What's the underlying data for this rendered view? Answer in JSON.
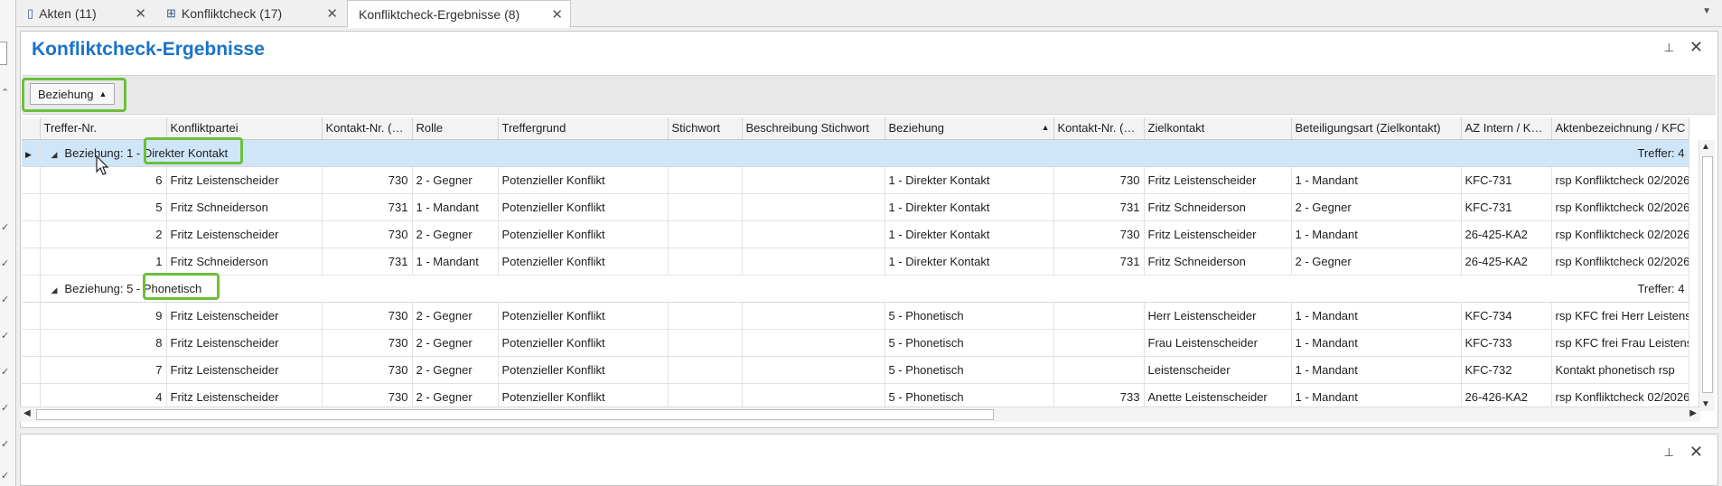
{
  "tabs": [
    {
      "label": "Akten (11)",
      "icon": "file-icon",
      "close": "✕"
    },
    {
      "label": "Konfliktcheck (17)",
      "icon": "network-icon",
      "close": "✕"
    },
    {
      "label": "Konfliktcheck-Ergebnisse (8)",
      "icon": "",
      "close": "✕",
      "active": true
    }
  ],
  "panel": {
    "title": "Konfliktcheck-Ergebnisse",
    "group_chip": "Beziehung"
  },
  "columns": [
    "Treffer-Nr.",
    "Konfliktpartei",
    "Kontakt-Nr. (…",
    "Rolle",
    "Treffergrund",
    "Stichwort",
    "Beschreibung Stichwort",
    "Beziehung",
    "Kontakt-Nr. (…",
    "Zielkontakt",
    "Beteiligungsart (Zielkontakt)",
    "AZ Intern / K…",
    "Aktenbezeichnung / KFC"
  ],
  "groups": [
    {
      "label": "Beziehung: 1 - ",
      "value": "Direkter Kontakt",
      "hits": "Treffer: 4",
      "rows": [
        [
          "6",
          "Fritz Leistenscheider",
          "730",
          "2 - Gegner",
          "Potenzieller Konflikt",
          "",
          "",
          "1 - Direkter Kontakt",
          "730",
          "Fritz Leistenscheider",
          "1 - Mandant",
          "KFC-731",
          "rsp Konfliktcheck 02/2026"
        ],
        [
          "5",
          "Fritz Schneiderson",
          "731",
          "1 - Mandant",
          "Potenzieller Konflikt",
          "",
          "",
          "1 - Direkter Kontakt",
          "731",
          "Fritz Schneiderson",
          "2 - Gegner",
          "KFC-731",
          "rsp Konfliktcheck 02/2026"
        ],
        [
          "2",
          "Fritz Leistenscheider",
          "730",
          "2 - Gegner",
          "Potenzieller Konflikt",
          "",
          "",
          "1 - Direkter Kontakt",
          "730",
          "Fritz Leistenscheider",
          "1 - Mandant",
          "26-425-KA2",
          "rsp Konfliktcheck 02/2026"
        ],
        [
          "1",
          "Fritz Schneiderson",
          "731",
          "1 - Mandant",
          "Potenzieller Konflikt",
          "",
          "",
          "1 - Direkter Kontakt",
          "731",
          "Fritz Schneiderson",
          "2 - Gegner",
          "26-425-KA2",
          "rsp Konfliktcheck 02/2026"
        ]
      ]
    },
    {
      "label": "Beziehung: 5 - ",
      "value": "Phonetisch",
      "hits": "Treffer: 4",
      "rows": [
        [
          "9",
          "Fritz Leistenscheider",
          "730",
          "2 - Gegner",
          "Potenzieller Konflikt",
          "",
          "",
          "5 - Phonetisch",
          "",
          "Herr Leistenscheider",
          "1 - Mandant",
          "KFC-734",
          "rsp KFC frei Herr Leistensc"
        ],
        [
          "8",
          "Fritz Leistenscheider",
          "730",
          "2 - Gegner",
          "Potenzieller Konflikt",
          "",
          "",
          "5 - Phonetisch",
          "",
          "Frau Leistenscheider",
          "1 - Mandant",
          "KFC-733",
          "rsp KFC frei Frau Leistensc"
        ],
        [
          "7",
          "Fritz Leistenscheider",
          "730",
          "2 - Gegner",
          "Potenzieller Konflikt",
          "",
          "",
          "5 - Phonetisch",
          "",
          "Leistenscheider",
          "1 - Mandant",
          "KFC-732",
          "Kontakt phonetisch rsp"
        ],
        [
          "4",
          "Fritz Leistenscheider",
          "730",
          "2 - Gegner",
          "Potenzieller Konflikt",
          "",
          "",
          "5 - Phonetisch",
          "733",
          "Anette Leistenscheider",
          "1 - Mandant",
          "26-426-KA2",
          "rsp Konfliktcheck 02/2026"
        ]
      ]
    }
  ],
  "colors": {
    "accent": "#1a73c8",
    "highlight": "#6cbf3c",
    "selected_row": "#cfe6f9"
  }
}
